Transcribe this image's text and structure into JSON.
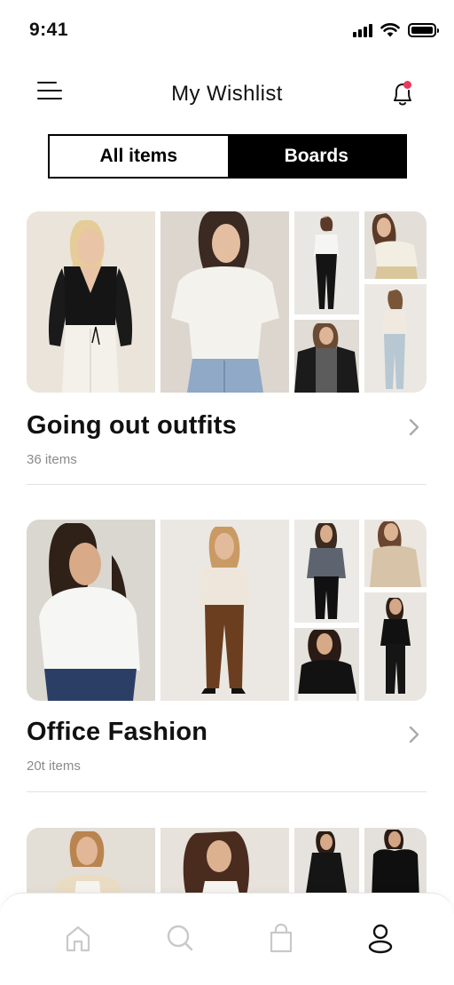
{
  "status_bar": {
    "time": "9:41"
  },
  "header": {
    "title": "My Wishlist"
  },
  "tabs": [
    {
      "label": "All items",
      "active": false
    },
    {
      "label": "Boards",
      "active": true
    }
  ],
  "boards": [
    {
      "title": "Going out outfits",
      "count": "36 items"
    },
    {
      "title": "Office Fashion",
      "count": "20t items"
    }
  ],
  "bottom_nav": {
    "items": [
      "home-icon",
      "search-icon",
      "shopping-bag-icon",
      "profile-icon"
    ],
    "active_item": "profile-icon"
  },
  "colors": {
    "accent": "#000000",
    "notification_dot": "#e8385c",
    "muted_text": "#8a8a8a",
    "inactive_icon": "#c9c9c9"
  }
}
